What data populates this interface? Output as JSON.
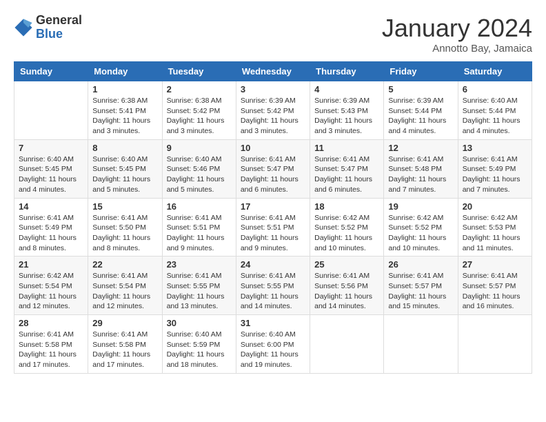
{
  "logo": {
    "general": "General",
    "blue": "Blue"
  },
  "title": "January 2024",
  "subtitle": "Annotto Bay, Jamaica",
  "days_of_week": [
    "Sunday",
    "Monday",
    "Tuesday",
    "Wednesday",
    "Thursday",
    "Friday",
    "Saturday"
  ],
  "weeks": [
    [
      {
        "day": "",
        "info": ""
      },
      {
        "day": "1",
        "info": "Sunrise: 6:38 AM\nSunset: 5:41 PM\nDaylight: 11 hours\nand 3 minutes."
      },
      {
        "day": "2",
        "info": "Sunrise: 6:38 AM\nSunset: 5:42 PM\nDaylight: 11 hours\nand 3 minutes."
      },
      {
        "day": "3",
        "info": "Sunrise: 6:39 AM\nSunset: 5:42 PM\nDaylight: 11 hours\nand 3 minutes."
      },
      {
        "day": "4",
        "info": "Sunrise: 6:39 AM\nSunset: 5:43 PM\nDaylight: 11 hours\nand 3 minutes."
      },
      {
        "day": "5",
        "info": "Sunrise: 6:39 AM\nSunset: 5:44 PM\nDaylight: 11 hours\nand 4 minutes."
      },
      {
        "day": "6",
        "info": "Sunrise: 6:40 AM\nSunset: 5:44 PM\nDaylight: 11 hours\nand 4 minutes."
      }
    ],
    [
      {
        "day": "7",
        "info": "Sunrise: 6:40 AM\nSunset: 5:45 PM\nDaylight: 11 hours\nand 4 minutes."
      },
      {
        "day": "8",
        "info": "Sunrise: 6:40 AM\nSunset: 5:45 PM\nDaylight: 11 hours\nand 5 minutes."
      },
      {
        "day": "9",
        "info": "Sunrise: 6:40 AM\nSunset: 5:46 PM\nDaylight: 11 hours\nand 5 minutes."
      },
      {
        "day": "10",
        "info": "Sunrise: 6:41 AM\nSunset: 5:47 PM\nDaylight: 11 hours\nand 6 minutes."
      },
      {
        "day": "11",
        "info": "Sunrise: 6:41 AM\nSunset: 5:47 PM\nDaylight: 11 hours\nand 6 minutes."
      },
      {
        "day": "12",
        "info": "Sunrise: 6:41 AM\nSunset: 5:48 PM\nDaylight: 11 hours\nand 7 minutes."
      },
      {
        "day": "13",
        "info": "Sunrise: 6:41 AM\nSunset: 5:49 PM\nDaylight: 11 hours\nand 7 minutes."
      }
    ],
    [
      {
        "day": "14",
        "info": "Sunrise: 6:41 AM\nSunset: 5:49 PM\nDaylight: 11 hours\nand 8 minutes."
      },
      {
        "day": "15",
        "info": "Sunrise: 6:41 AM\nSunset: 5:50 PM\nDaylight: 11 hours\nand 8 minutes."
      },
      {
        "day": "16",
        "info": "Sunrise: 6:41 AM\nSunset: 5:51 PM\nDaylight: 11 hours\nand 9 minutes."
      },
      {
        "day": "17",
        "info": "Sunrise: 6:41 AM\nSunset: 5:51 PM\nDaylight: 11 hours\nand 9 minutes."
      },
      {
        "day": "18",
        "info": "Sunrise: 6:42 AM\nSunset: 5:52 PM\nDaylight: 11 hours\nand 10 minutes."
      },
      {
        "day": "19",
        "info": "Sunrise: 6:42 AM\nSunset: 5:52 PM\nDaylight: 11 hours\nand 10 minutes."
      },
      {
        "day": "20",
        "info": "Sunrise: 6:42 AM\nSunset: 5:53 PM\nDaylight: 11 hours\nand 11 minutes."
      }
    ],
    [
      {
        "day": "21",
        "info": "Sunrise: 6:42 AM\nSunset: 5:54 PM\nDaylight: 11 hours\nand 12 minutes."
      },
      {
        "day": "22",
        "info": "Sunrise: 6:41 AM\nSunset: 5:54 PM\nDaylight: 11 hours\nand 12 minutes."
      },
      {
        "day": "23",
        "info": "Sunrise: 6:41 AM\nSunset: 5:55 PM\nDaylight: 11 hours\nand 13 minutes."
      },
      {
        "day": "24",
        "info": "Sunrise: 6:41 AM\nSunset: 5:55 PM\nDaylight: 11 hours\nand 14 minutes."
      },
      {
        "day": "25",
        "info": "Sunrise: 6:41 AM\nSunset: 5:56 PM\nDaylight: 11 hours\nand 14 minutes."
      },
      {
        "day": "26",
        "info": "Sunrise: 6:41 AM\nSunset: 5:57 PM\nDaylight: 11 hours\nand 15 minutes."
      },
      {
        "day": "27",
        "info": "Sunrise: 6:41 AM\nSunset: 5:57 PM\nDaylight: 11 hours\nand 16 minutes."
      }
    ],
    [
      {
        "day": "28",
        "info": "Sunrise: 6:41 AM\nSunset: 5:58 PM\nDaylight: 11 hours\nand 17 minutes."
      },
      {
        "day": "29",
        "info": "Sunrise: 6:41 AM\nSunset: 5:58 PM\nDaylight: 11 hours\nand 17 minutes."
      },
      {
        "day": "30",
        "info": "Sunrise: 6:40 AM\nSunset: 5:59 PM\nDaylight: 11 hours\nand 18 minutes."
      },
      {
        "day": "31",
        "info": "Sunrise: 6:40 AM\nSunset: 6:00 PM\nDaylight: 11 hours\nand 19 minutes."
      },
      {
        "day": "",
        "info": ""
      },
      {
        "day": "",
        "info": ""
      },
      {
        "day": "",
        "info": ""
      }
    ]
  ]
}
